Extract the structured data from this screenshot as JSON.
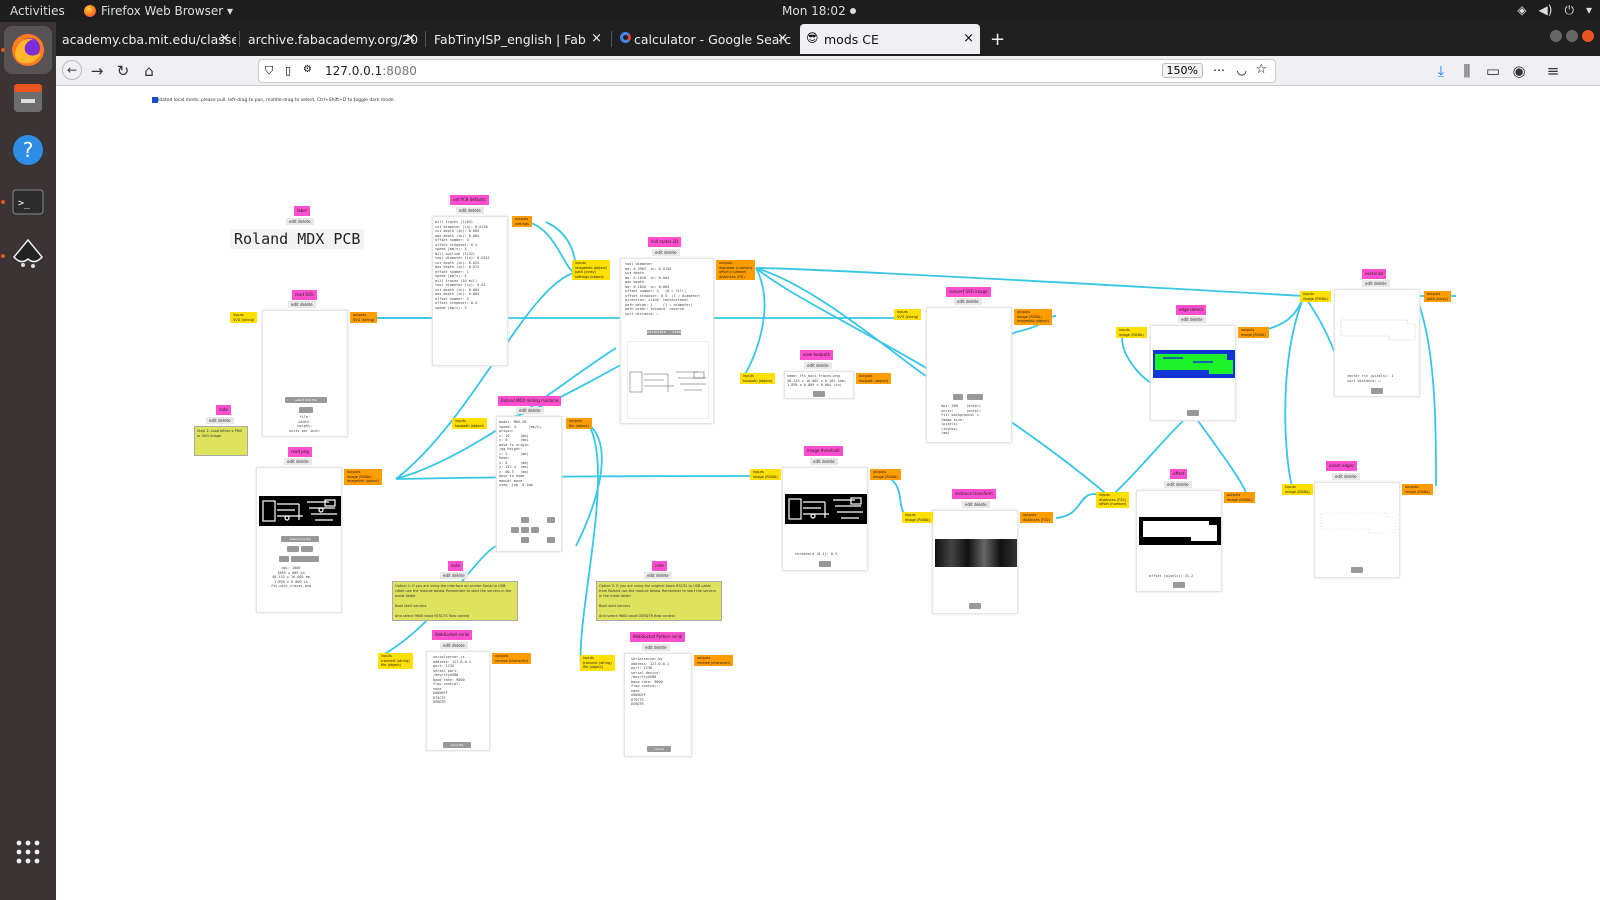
{
  "system": {
    "activities": "Activities",
    "app_name": "Firefox Web Browser ▾",
    "clock": "Mon 18:02"
  },
  "tabs": [
    {
      "label": "academy.cba.mit.edu/classe",
      "close": "×"
    },
    {
      "label": "archive.fabacademy.org/20",
      "close": "×"
    },
    {
      "label": "FabTinyISP_english | Fab",
      "close": "×"
    },
    {
      "label": "calculator - Google Searc",
      "close": "×"
    },
    {
      "label": "mods CE",
      "close": "×"
    }
  ],
  "new_tab": "+",
  "nav": {
    "url_host": "127.0.0.1",
    "url_port": ":8080",
    "zoom": "150%"
  },
  "canvas": {
    "hint": "outdated local mods, please pull. left-drag to pan, middle-drag to select, Ctrl+Shift+D to toggle dark mode",
    "page_title": "Roland MDX PCB",
    "modules": {
      "label": {
        "title": "label",
        "edit": "edit delete"
      },
      "read_svg": {
        "title": "read SVG",
        "edit": "edit delete",
        "in": "inputs\nSVG (string)",
        "out": "outputs\nSVG (string)",
        "btn": "select SVG file",
        "info": "file:\nwidth:\nheight:\nunits per inch:"
      },
      "note_left": {
        "title": "note",
        "edit": "edit delete",
        "text": "Step 1: Load either a PNG or SVG image"
      },
      "read_png": {
        "title": "read png",
        "edit": "edit delete",
        "out": "outputs\nimage (RGBA)\nimageInfo (object)",
        "info": "dpi: 1000\n1885 x 809 px\n48.133 x 16.002 mm\n1.895 x 0.809 in\nfts_mini_traces.png",
        "btns": "select png file"
      },
      "set_pcb": {
        "title": "set PCB defaults",
        "edit": "edit delete",
        "out": "outputs\nsettings",
        "lines": "mill traces (1/64)\ncut diameter (in): 0.0156\ncut depth (in): 0.004\nmax depth (in): 0.004\noffset number: 4\noffset stepover: 0.5\nspeed (mm/s): 4\nmill outline (1/32)\ntool diameter (in): 0.0312\ncut depth (in): 0.024\nmax depth (in): 0.072\noffset number: 1\nspeed (mm/s): 4\nmill traces (10 mil)\ntool diameter (in): 0.01\ncut depth (in): 0.004\nmax depth (in): 0.004\noffset number: 4\noffset stepover: 0.5\nspeed (mm/s): 2"
      },
      "mill_raster": {
        "title": "mill raster 2D",
        "edit": "edit delete",
        "in": "inputs\nimageInfo (object)\npath (array)\nsettings (object)",
        "out": "outputs\ndiameter (number)\noffset (number)\ndistances (FSI)",
        "lines": "tool diameter\nmm: 0.3962  in: 0.0156\ncut depth\nmm: 0.1016  in: 0.004\nmax depth\nmm: 0.1016  in: 0.004\noffset number: 4   (0 = fill)\noffset stepover: 0.5  (1 = diameter)\ndirection: climb  conventional\npath merge: 1     (1 = diameter)\npath order: forward  reverse\nsort distance: ☐",
        "btns": "calculate   view"
      },
      "roland": {
        "title": "Roland MDX milling machine",
        "edit": "edit delete",
        "in": "inputs\ntoolpath (object)",
        "out": "outputs\nfile (object)",
        "lines": "model: MDX-20\nspeed: 4      (mm/s)\norigin:\nx: 10     (mm)\ny: 0      (mm)\nmove to origin\njog height:\nz: 2      (mm)\nhome:\nx: 0      (mm)\ny: 152.4  (mm)\nz: 60.5   (mm)\nmove to home\nmanual move:\nstep  jog  0.1mm"
      },
      "view_toolpath": {
        "title": "view toolpath",
        "edit": "edit delete",
        "in": "inputs\ntoolpath (object)",
        "out": "outputs\ntoolpath (object)",
        "lines": "name: fts_mini_traces.png\n48.133 x 16.002 x 0.102 (mm)\n1.895 x 0.809 x 0.004 (in)"
      },
      "convert_svg": {
        "title": "convert SVG image",
        "edit": "edit delete",
        "in": "inputs\nSVG (string)",
        "out": "outputs\nimage (RGBA)\nimageInfo (object)",
        "lines": "dpi: 500    (enter)\nunits:      (enter)\nfill background: ☑\nimage size:\n(pixels)\n(inches)\n(mm)"
      },
      "image_threshold": {
        "title": "image threshold",
        "edit": "edit delete",
        "in": "inputs\nimage (RGBA)",
        "out": "outputs\nimage (RGBA)",
        "lines": "threshold (0-1): 0.5"
      },
      "distance_transform": {
        "title": "distance transform",
        "edit": "edit delete",
        "in": "inputs\nimage (RGBA)",
        "out": "outputs\ndistances (F32)"
      },
      "edge_detect": {
        "title": "edge detect",
        "edit": "edit delete",
        "in": "inputs\nimage (RGBA)",
        "out": "outputs\nimage (RGBA)"
      },
      "offset": {
        "title": "offset",
        "edit": "edit delete",
        "in": "inputs\ndistances (F32)\noffset (number)",
        "out": "outputs\nimage (RGBA)",
        "lines": "offset (pixels): 31.2"
      },
      "vectorize": {
        "title": "vectorize",
        "edit": "edit delete",
        "in": "inputs\nimage (RGBA)",
        "out": "outputs\npath (array)",
        "lines": "vector fit (pixels): 1\nsort distance: ☑"
      },
      "orient_edges": {
        "title": "orient edges",
        "edit": "edit delete",
        "in": "inputs\nimage (RGBA)",
        "out": "outputs\nimage (RGBA)"
      },
      "note_opt1": {
        "title": "note",
        "edit": "edit delete",
        "text": "Option 1: If you are using the Interface on similar Serial to USB cable use the module below. Remember to start the servers in the mods folder\n\nBoot start servers\n\nAnd select 9600 baud RTSCTS flow control"
      },
      "note_opt2": {
        "title": "note",
        "edit": "edit delete",
        "text": "Option 2: If you are using the original black RS232 to USB cable from Roland use the module below. Remember to start the servers in the mods folder\n\nBoot start servers\n\nAnd select 9600 baud DSRDTR flow control"
      },
      "websocket_serial": {
        "title": "WebSocket serial",
        "edit": "edit delete",
        "in": "inputs\ntransmit (string)\nfile (object)",
        "out": "outputs\nreceive (character)",
        "lines": "serialserver.js\naddress: 127.0.0.1\nport: 1235\nserial port:\n/dev/ttyUSB0\nbaud rate: 9600\nflow control:\nnone\nXONXOFF\nRTSCTS\nDSRDTR",
        "btn": "send file"
      },
      "websocket_python": {
        "title": "WebSocket Python serial",
        "edit": "edit delete",
        "in": "inputs\ntransmit (string)\nfile (object)",
        "out": "outputs\nreceive (character)",
        "lines": "serialserver.py\naddress: 127.0.0.1\nport: 1236\nserial device:\n/dev/ttyUSB0\nbaud rate: 9600\nflow control:\nnone\nXONXOFF\nRTSCTS\nDSRDTR",
        "btn": "cancel"
      }
    }
  },
  "colors": {
    "wire": "#36c6e6",
    "title": "#ff4fd0",
    "input": "#ffe000",
    "output": "#ff9d00",
    "note": "#dde35c"
  }
}
